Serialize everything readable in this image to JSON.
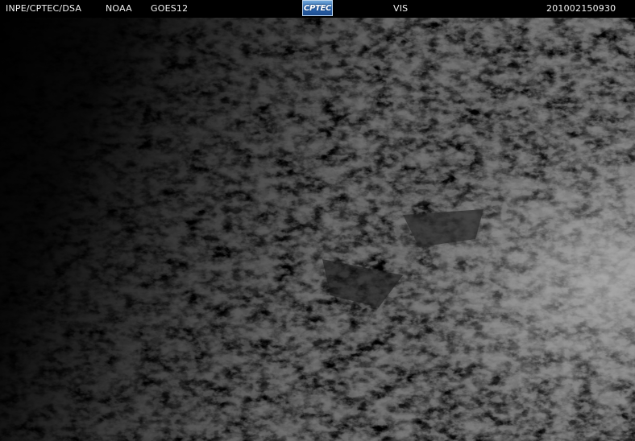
{
  "header": {
    "agency": "INPE/CPTEC/DSA",
    "provider": "NOAA",
    "satellite": "GOES12",
    "logo_text": "CPTEC",
    "channel": "VIS",
    "timestamp": "201002150930"
  },
  "image": {
    "icon": "satellite-cloud-imagery",
    "palette": {
      "space": "#000000",
      "dark_cloud": "#1a1a1a",
      "mid_cloud": "#4a4a4a",
      "bright_cloud": "#8c8c8c"
    }
  }
}
